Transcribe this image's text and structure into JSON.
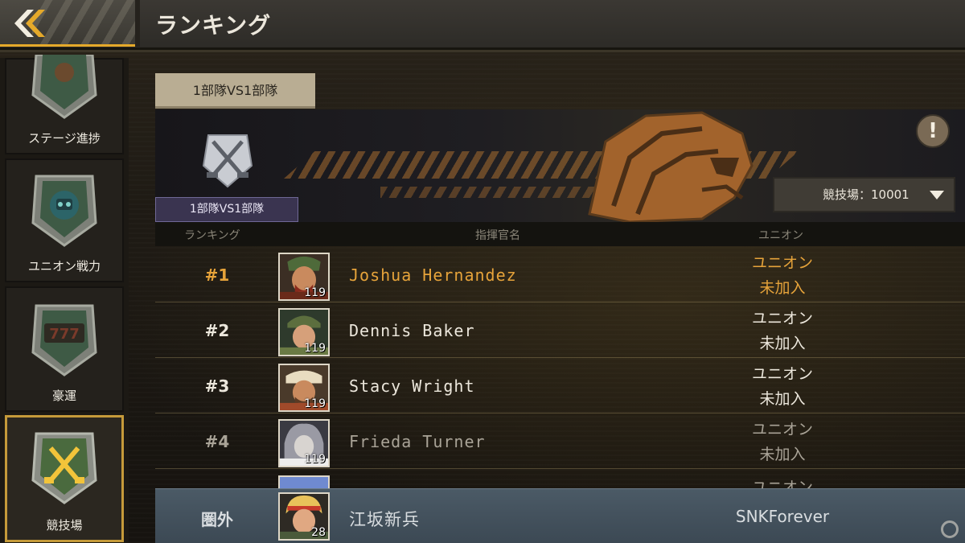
{
  "header": {
    "title": "ランキング",
    "back_icon": "double-chevron-left-icon"
  },
  "sidebar": {
    "items": [
      {
        "label": "ステージ進捗",
        "icon": "stage-badge-icon",
        "active": false
      },
      {
        "label": "ユニオン戦力",
        "icon": "union-badge-icon",
        "active": false
      },
      {
        "label": "豪運",
        "icon": "lucky-777-badge-icon",
        "active": false
      },
      {
        "label": "競技場",
        "icon": "arena-badge-icon",
        "active": true
      }
    ]
  },
  "tab": {
    "label": "1部隊VS1部隊"
  },
  "banner": {
    "mode_label": "1部隊VS1部隊",
    "arena_select": "競技場：10001",
    "info_label": "!"
  },
  "columns": {
    "rank": "ランキング",
    "commander": "指揮官名",
    "union": "ユニオン"
  },
  "rows": [
    {
      "rank": "#1",
      "name": "Joshua Hernandez",
      "level": "119",
      "union_line1": "ユニオン",
      "union_line2": "未加入"
    },
    {
      "rank": "#2",
      "name": "Dennis Baker",
      "level": "119",
      "union_line1": "ユニオン",
      "union_line2": "未加入"
    },
    {
      "rank": "#3",
      "name": "Stacy Wright",
      "level": "119",
      "union_line1": "ユニオン",
      "union_line2": "未加入"
    },
    {
      "rank": "#4",
      "name": "Frieda Turner",
      "level": "119",
      "union_line1": "ユニオン",
      "union_line2": "未加入"
    }
  ],
  "partial_row": {
    "union_line1": "ユニオン"
  },
  "self": {
    "rank": "圏外",
    "name": "江坂新兵",
    "level": "28",
    "union": "SNKForever"
  },
  "colors": {
    "accent_gold": "#e6a33a",
    "tab_bg": "#b9ad93",
    "self_row_bg": "#4b5a66",
    "active_border": "#c59a3a"
  }
}
